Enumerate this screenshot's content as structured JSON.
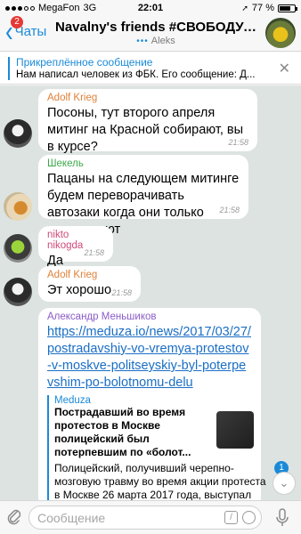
{
  "status": {
    "carrier": "MegaFon",
    "network": "3G",
    "time": "22:01",
    "battery": "77 %",
    "battery_level": 0.77
  },
  "nav": {
    "back_label": "Чаты",
    "badge": "2",
    "title": "Navalny's friends #СВОБОДУФ...",
    "typing_user": "Aleks"
  },
  "pinned": {
    "title": "Прикреплённое сообщение",
    "text": "Нам написал человек из ФБК. Его сообщение: Д..."
  },
  "messages": [
    {
      "author": "Adolf Krieg",
      "author_color": "#e0813a",
      "text": "Посоны, тут второго апреля митинг на Красной собирают, вы в курсе?",
      "time": "21:58"
    },
    {
      "author": "Шекель",
      "author_color": "#3da94a",
      "text": "Пацаны на следующем митинге будем переворачивать автозаки когда они только подъезжают",
      "time": "21:58"
    },
    {
      "author": "nikto nikogda",
      "author_color": "#d24a7a",
      "text": "Да",
      "time": "21:58"
    },
    {
      "author": "Adolf Krieg",
      "author_color": "#e0813a",
      "text": "Эт хорошо",
      "time": "21:58"
    },
    {
      "author": "Александр Меньшиков",
      "author_color": "#8a5bc9",
      "link": "https://meduza.io/news/2017/03/27/postradavshiy-vo-vremya-protestov-v-moskve-politseyskiy-byl-poterpevshim-po-bolotnomu-delu",
      "preview_site": "Meduza",
      "preview_title": "Пострадавший во время протестов в Москве полицейский был потерпевшим по «болот...",
      "preview_desc": "Полицейский, получивший черепно-мозговую травму во время акции протеста в Москве 26 марта 2017 года, выступал"
    }
  ],
  "unread_count": "1",
  "input": {
    "placeholder": "Сообщение",
    "cmd_label": "/"
  }
}
